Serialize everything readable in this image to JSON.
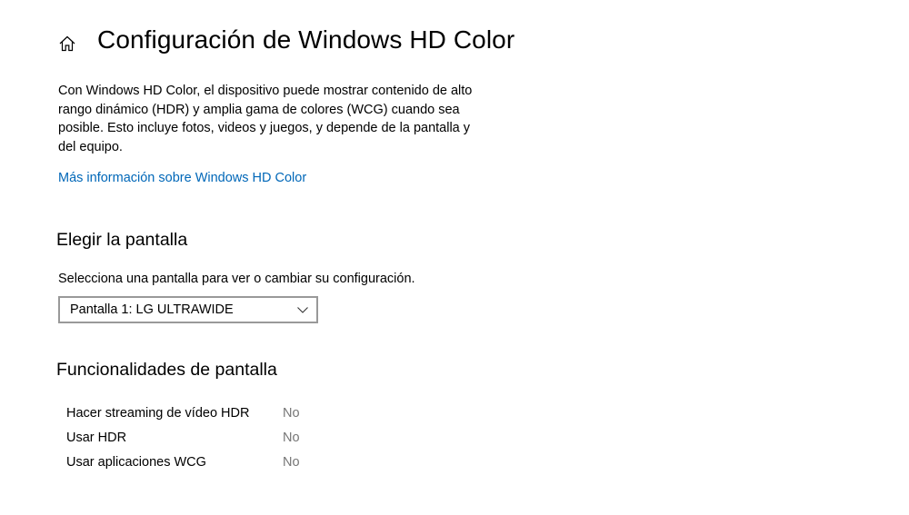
{
  "theme": {
    "accent": "#0067b8",
    "muted_text": "#767676",
    "select_border": "#999999"
  },
  "header": {
    "home_icon": "home-icon",
    "title": "Configuración de Windows HD Color"
  },
  "intro": {
    "description": "Con Windows HD Color, el dispositivo puede mostrar contenido de alto rango dinámico (HDR) y amplia gama de colores (WCG) cuando sea posible. Esto incluye fotos, videos y juegos, y depende de la pantalla y del equipo.",
    "link": "Más información sobre Windows HD Color"
  },
  "choose_display": {
    "heading": "Elegir la pantalla",
    "label": "Selecciona una pantalla para ver o cambiar su configuración.",
    "selected": "Pantalla 1: LG ULTRAWIDE",
    "dropdown_icon": "chevron-down-icon"
  },
  "capabilities": {
    "heading": "Funcionalidades de pantalla",
    "items": [
      {
        "label": "Hacer streaming de vídeo HDR",
        "value": "No"
      },
      {
        "label": "Usar HDR",
        "value": "No"
      },
      {
        "label": "Usar aplicaciones WCG",
        "value": "No"
      }
    ]
  }
}
